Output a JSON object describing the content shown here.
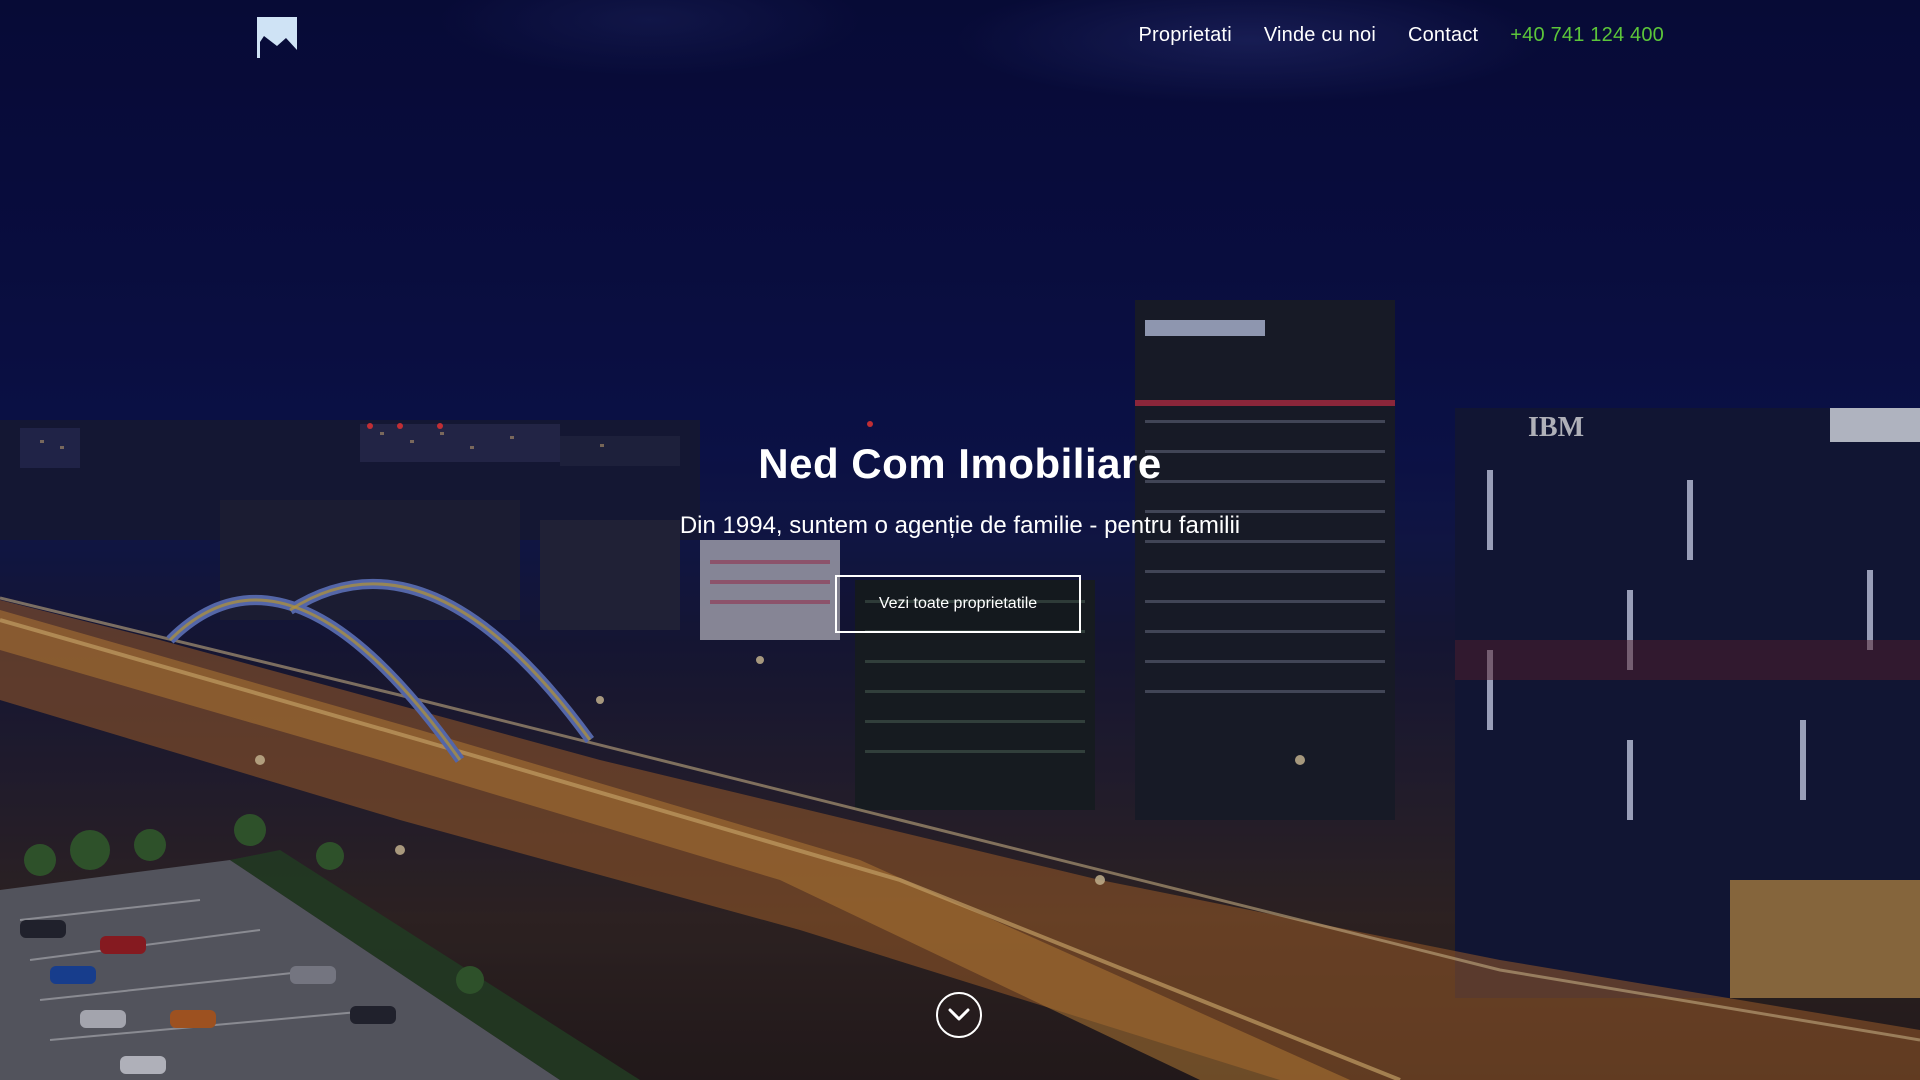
{
  "brand": {
    "logo_icon": "flag-logo-icon"
  },
  "nav": {
    "items": [
      {
        "label": "Proprietati"
      },
      {
        "label": "Vinde cu noi"
      },
      {
        "label": "Contact"
      }
    ],
    "phone": "+40 741 124 400",
    "phone_color": "#5cc63a"
  },
  "hero": {
    "title": "Ned Com Imobiliare",
    "subtitle": "Din 1994, suntem o agenție de familie - pentru familii",
    "cta_label": "Vezi toate proprietatile",
    "scroll_icon": "chevron-down-circle-icon",
    "billboard_text": "IBM"
  }
}
